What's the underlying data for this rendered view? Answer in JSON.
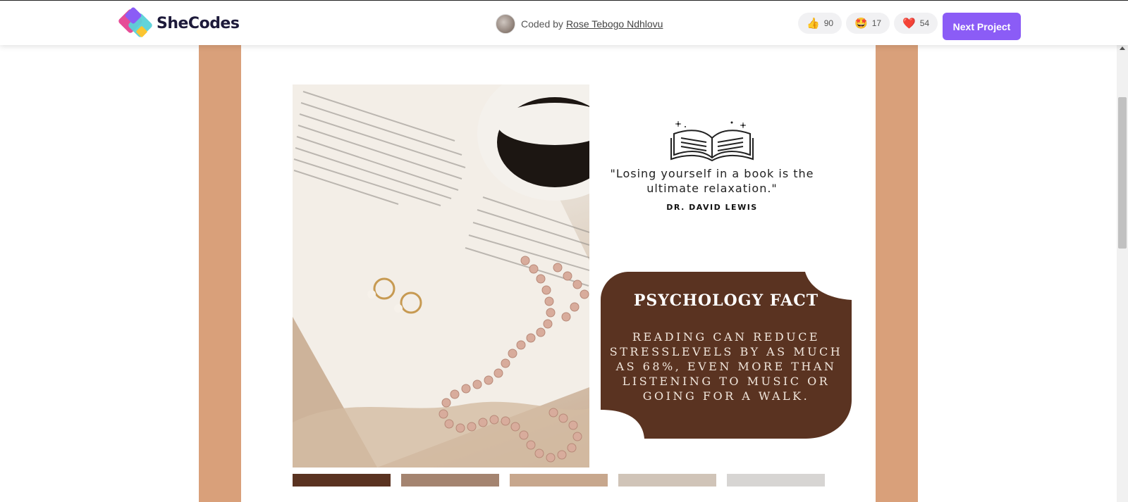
{
  "header": {
    "logo_text": "SheCodes",
    "coded_by_prefix": "Coded by",
    "author_name": "Rose Tebogo Ndhlovu",
    "reactions": [
      {
        "icon": "thumbs-up-icon",
        "emoji": "👍",
        "count": "90"
      },
      {
        "icon": "star-struck-icon",
        "emoji": "🤩",
        "count": "17"
      },
      {
        "icon": "heart-icon",
        "emoji": "❤️",
        "count": "54"
      }
    ],
    "next_button_label": "Next Project"
  },
  "poster": {
    "quote": "\"Losing yourself in a book is the ultimate relaxation.\"",
    "author": "DR. DAVID LEWIS",
    "fact_title": "PSYCHOLOGY FACT",
    "fact_text": "Reading can reduce stresslevels by as much as 68%, even more than listening to music or going for a walk."
  },
  "colors": {
    "frame": "#d9a07a",
    "fact_box": "#5a3321",
    "accent_button": "#8b5cf6",
    "swatches": [
      "#5a3321",
      "#a48470",
      "#c7a78d",
      "#d0c4b8",
      "#d7d5d3"
    ]
  }
}
